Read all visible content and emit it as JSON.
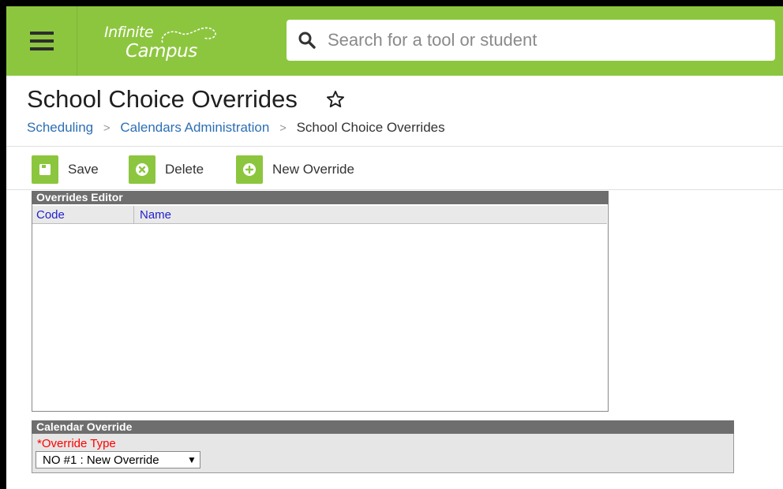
{
  "header": {
    "logo_line1": "Infinite",
    "logo_line2": "Campus",
    "search_placeholder": "Search for a tool or student",
    "accent_color": "#8cc63f"
  },
  "page": {
    "title": "School Choice Overrides",
    "breadcrumb": [
      "Scheduling",
      "Calendars Administration",
      "School Choice Overrides"
    ]
  },
  "toolbar": {
    "save_label": "Save",
    "delete_label": "Delete",
    "new_label": "New Override"
  },
  "editor": {
    "title": "Overrides Editor",
    "columns": [
      "Code",
      "Name"
    ],
    "rows": []
  },
  "calendar_override": {
    "title": "Calendar Override",
    "field_label": "*Override Type",
    "selected_value": "NO #1 : New Override"
  },
  "icons": {
    "menu": "hamburger-menu-icon",
    "search": "search-icon",
    "favorite": "star-outline-icon",
    "save": "save-icon",
    "delete": "delete-circle-x-icon",
    "new": "plus-circle-icon"
  }
}
